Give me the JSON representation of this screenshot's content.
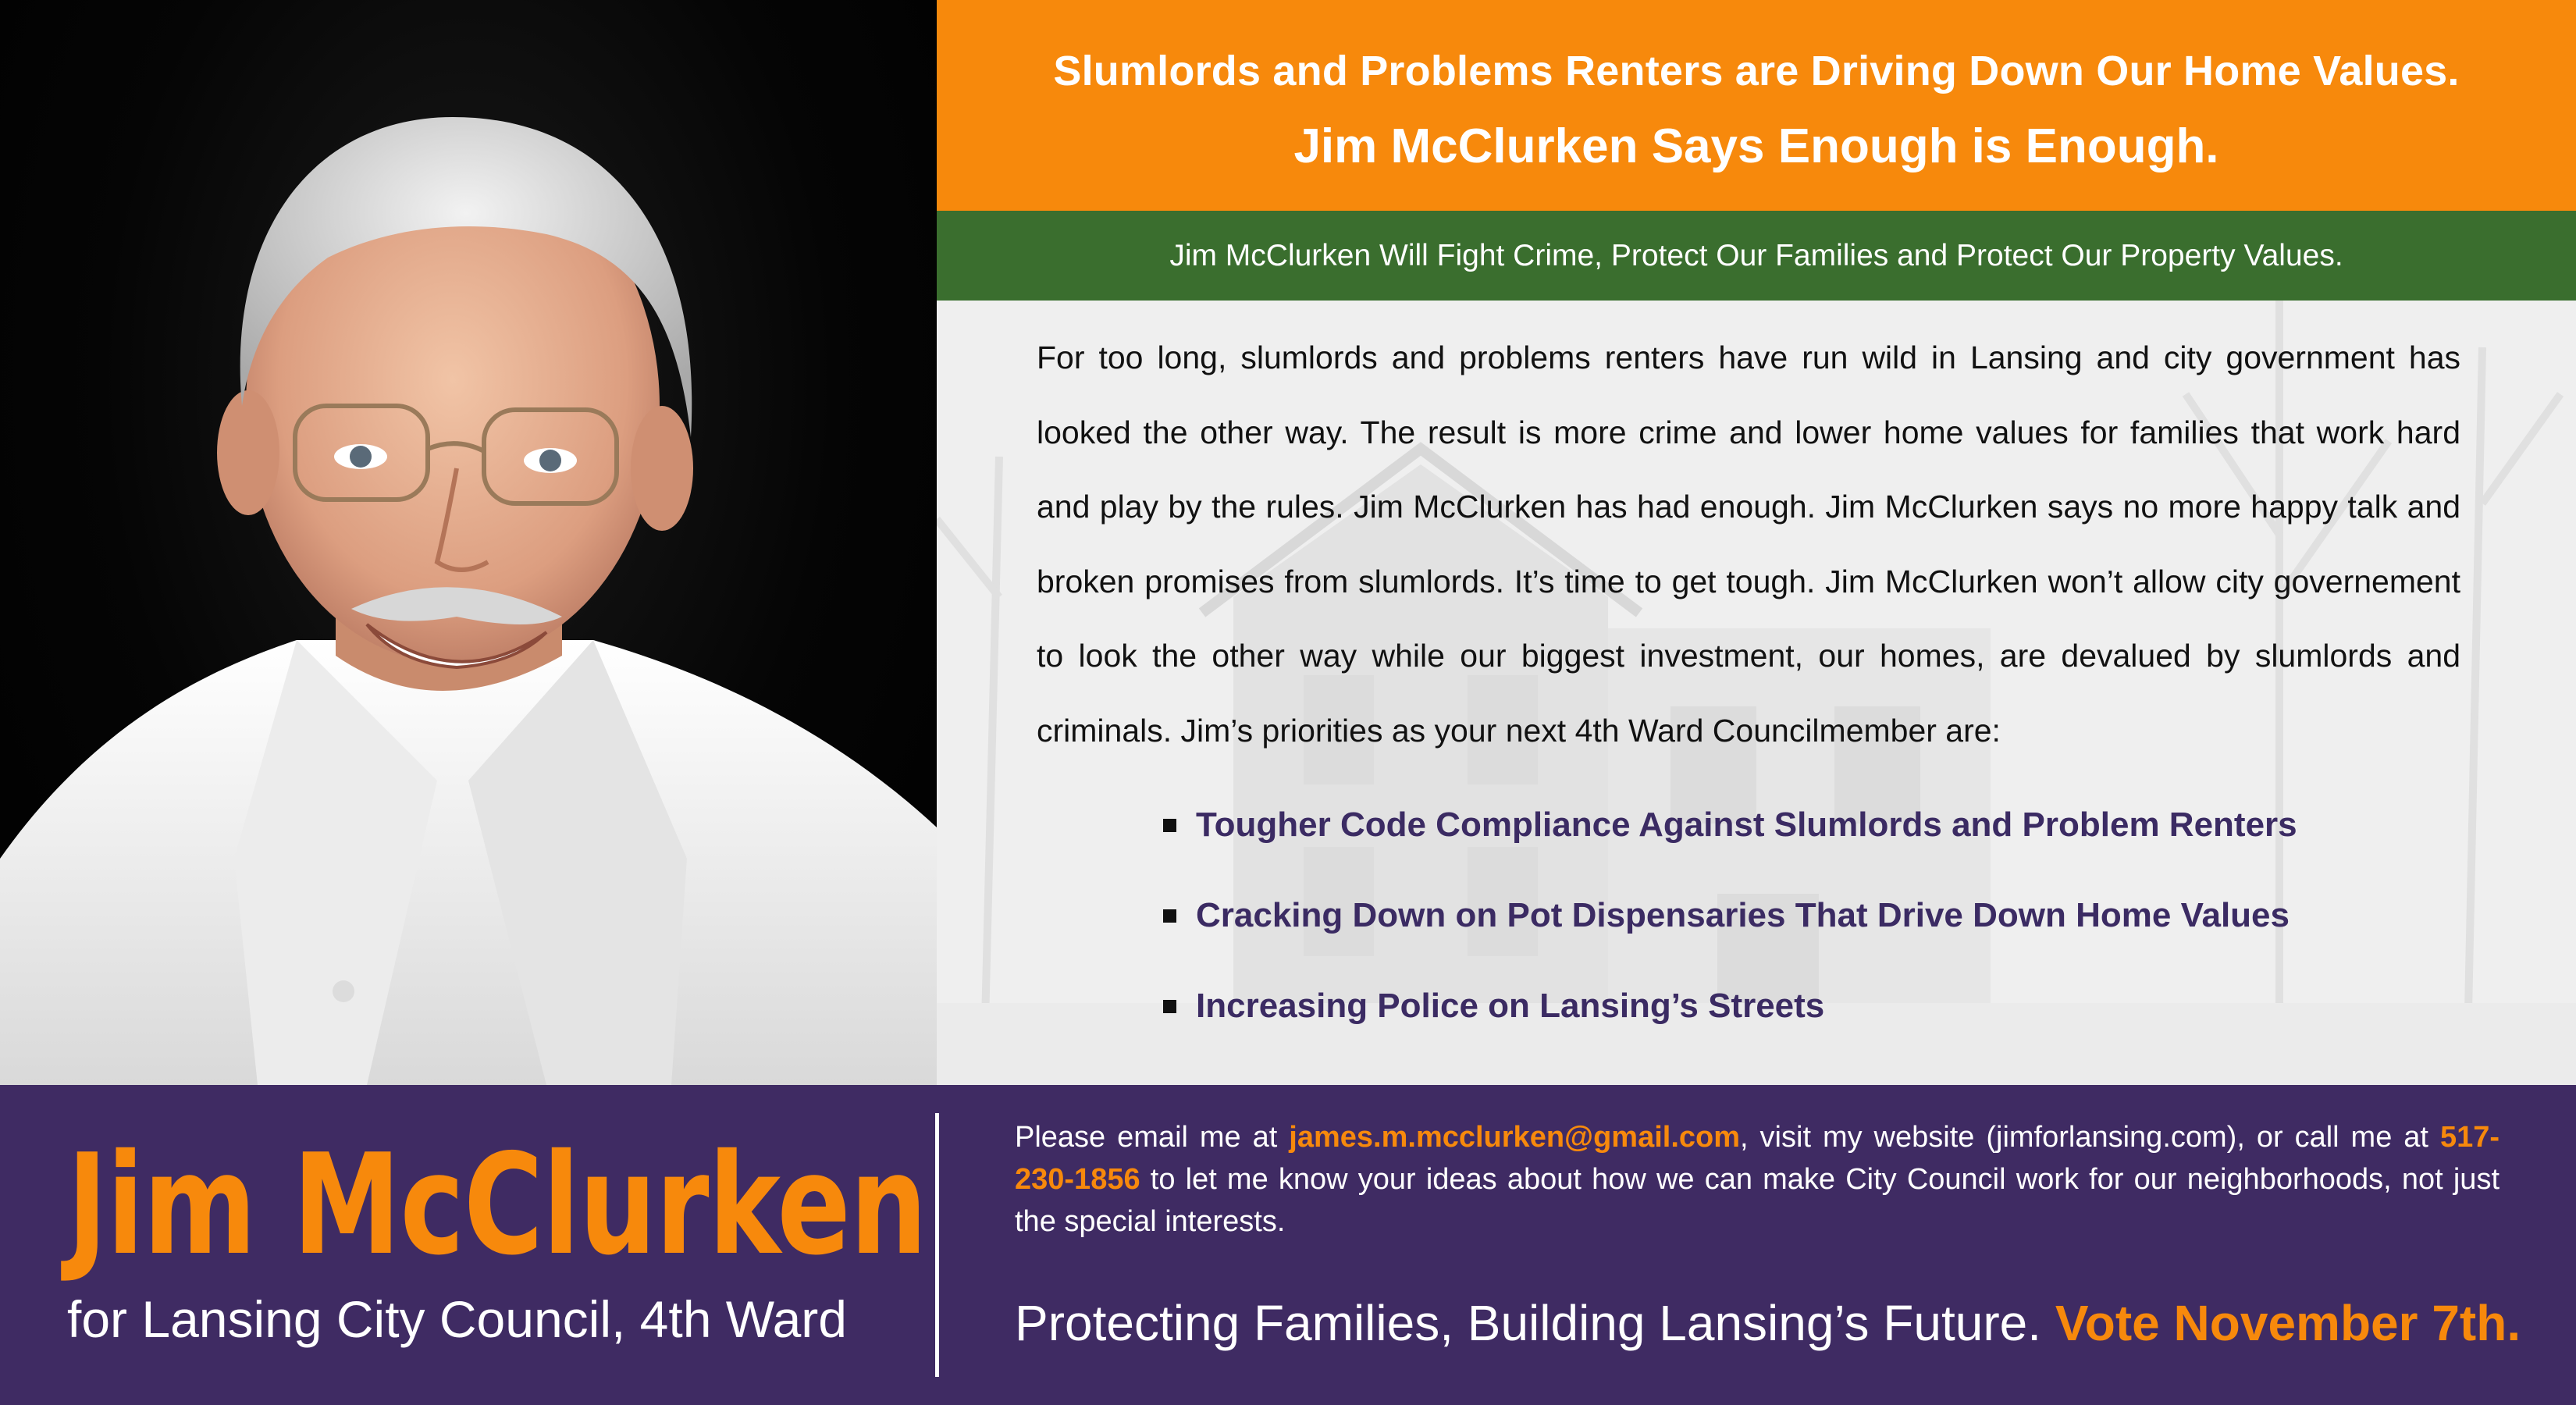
{
  "colors": {
    "orange": "#f7890c",
    "green": "#3a6e2e",
    "purple": "#3f2b63",
    "bullet_text": "#3b2b63"
  },
  "banner": {
    "line1": "Slumlords and Problems Renters are Driving Down Our Home Values.",
    "line2": "Jim McClurken Says Enough is Enough."
  },
  "green_bar": {
    "text": "Jim McClurken Will Fight Crime, Protect Our Families and Protect Our Property Values."
  },
  "body": {
    "paragraph": "For too long, slumlords and problems renters have run wild in Lansing and city government has looked the other way. The result is more crime and lower home values for families that work hard and play by the rules. Jim McClurken has had enough. Jim McClurken says no more happy talk and broken promises from slumlords. It’s time to get tough. Jim McClurken won’t allow city governement to look the other way while our biggest investment, our homes, are devalued by slumlords and criminals. Jim’s priorities as your next 4th Ward Councilmember are:",
    "priorities": [
      "Tougher Code Compliance Against Slumlords and Problem Renters",
      "Cracking Down on Pot Dispensaries That Drive Down Home Values",
      "Increasing Police on Lansing’s Streets"
    ]
  },
  "footer": {
    "name": "Jim McClurken",
    "subtitle": "for Lansing City Council, 4th Ward",
    "contact": {
      "intro": "Please email me at ",
      "email": "james.m.mcclurken@gmail.com",
      "mid": ", visit my website (jimforlansing.com), or call me at ",
      "phone": "517-230-1856",
      "outro": " to let me know your ideas about how we can make City Council work for our neighborhoods, not just the special interests."
    },
    "slogan": "Protecting Families, Building Lansing’s Future. ",
    "vote": "Vote November 7th."
  }
}
